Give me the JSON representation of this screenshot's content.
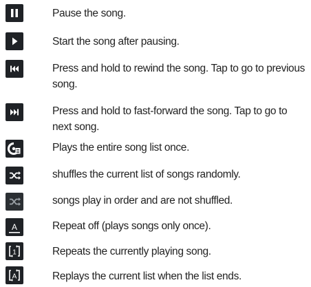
{
  "items": [
    {
      "icon": "pause-icon",
      "text": "Pause the song."
    },
    {
      "icon": "play-icon",
      "text": "Start the song after pausing."
    },
    {
      "icon": "rewind-previous-icon",
      "text": "Press and hold to rewind the song. Tap to go to previous song."
    },
    {
      "icon": "fast-forward-next-icon",
      "text": "Press and hold to fast-forward  the song. Tap to go to next song."
    },
    {
      "icon": "play-list-once-icon",
      "text": "Plays the entire song list once."
    },
    {
      "icon": "shuffle-on-icon",
      "text": "shuffles the current list of songs randomly."
    },
    {
      "icon": "shuffle-off-icon",
      "text": "songs play in order and are not shuffled."
    },
    {
      "icon": "repeat-off-icon",
      "text": "Repeat off (plays songs only once)."
    },
    {
      "icon": "repeat-one-icon",
      "text": "Repeats the currently playing song."
    },
    {
      "icon": "repeat-all-icon",
      "text": "Replays the current list when the list ends."
    }
  ],
  "colors": {
    "icon_bg": "#1f2226",
    "icon_fg": "#ffffff",
    "text": "#222222",
    "accent_red": "#c0392b"
  }
}
